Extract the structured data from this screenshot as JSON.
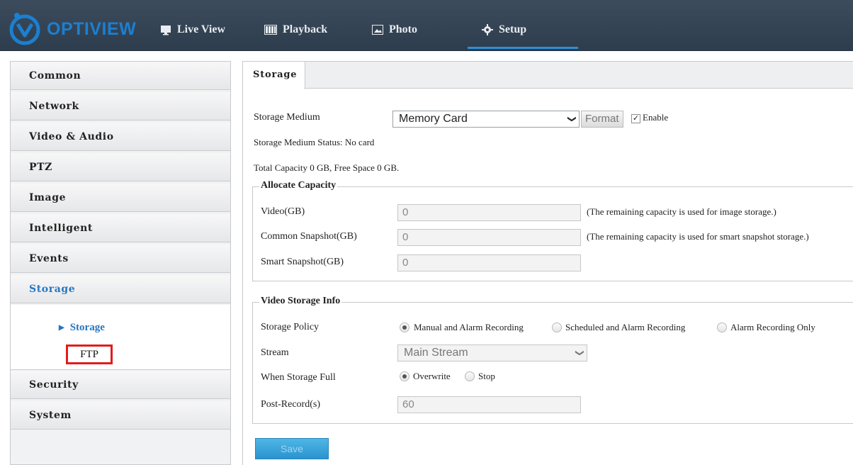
{
  "app": {
    "brand": "OPTIVIEW",
    "accent_color": "#2577c2",
    "highlight_color": "#e21c1c"
  },
  "topnav": {
    "items": [
      {
        "label": "Live View",
        "icon": "monitor-icon"
      },
      {
        "label": "Playback",
        "icon": "film-icon"
      },
      {
        "label": "Photo",
        "icon": "image-icon"
      },
      {
        "label": "Setup",
        "icon": "gear-icon",
        "active": true
      }
    ]
  },
  "sidebar": {
    "items": [
      {
        "label": "Common"
      },
      {
        "label": "Network"
      },
      {
        "label": "Video & Audio"
      },
      {
        "label": "PTZ"
      },
      {
        "label": "Image"
      },
      {
        "label": "Intelligent"
      },
      {
        "label": "Events"
      },
      {
        "label": "Storage",
        "active": true
      },
      {
        "label": "Security"
      },
      {
        "label": "System"
      }
    ],
    "submenu": {
      "storage_label": "Storage",
      "ftp_label": "FTP"
    }
  },
  "tab": {
    "label": "Storage"
  },
  "storage": {
    "medium_label": "Storage Medium",
    "medium_value": "Memory Card",
    "format_label": "Format",
    "enable_label": "Enable",
    "enable_checked": true,
    "status_text": "Storage Medium Status:  No card",
    "capacity_text": "Total Capacity  0  GB,  Free Space  0  GB."
  },
  "allocate": {
    "legend": "Allocate Capacity",
    "video_label": "Video(GB)",
    "video_value": "0",
    "video_note": "(The remaining capacity is used for image storage.)",
    "common_label": "Common Snapshot(GB)",
    "common_value": "0",
    "common_note": "(The remaining capacity is used for smart snapshot storage.)",
    "smart_label": "Smart Snapshot(GB)",
    "smart_value": "0"
  },
  "video_info": {
    "legend": "Video Storage Info",
    "policy_label": "Storage Policy",
    "policy_options": [
      "Manual and Alarm Recording",
      "Scheduled and Alarm Recording",
      "Alarm Recording Only"
    ],
    "policy_selected": 0,
    "stream_label": "Stream",
    "stream_value": "Main Stream",
    "full_label": "When Storage Full",
    "full_options": [
      "Overwrite",
      "Stop"
    ],
    "full_selected": 0,
    "post_label": "Post-Record(s)",
    "post_value": "60"
  },
  "save": {
    "label": "Save"
  }
}
